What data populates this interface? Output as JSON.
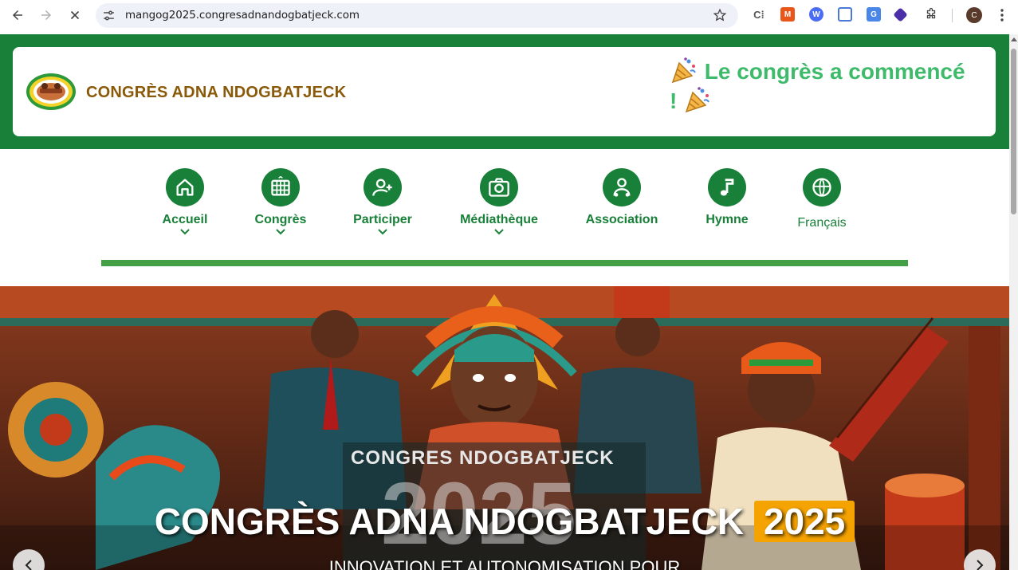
{
  "browser": {
    "url": "mangog2025.congresadnandogbatjeck.com",
    "profile_initial": "C"
  },
  "header": {
    "brand": "CONGRÈS ADNA NDOGBATJECK",
    "announcement_line1": "Le congrès a commencé",
    "announcement_line2": "!"
  },
  "nav": {
    "items": [
      {
        "label": "Accueil",
        "icon": "home-icon",
        "dropdown": true
      },
      {
        "label": "Congrès",
        "icon": "abacus-icon",
        "dropdown": true
      },
      {
        "label": "Participer",
        "icon": "user-add-icon",
        "dropdown": true
      },
      {
        "label": "Médiathèque",
        "icon": "camera-icon",
        "dropdown": true
      },
      {
        "label": "Association",
        "icon": "network-user-icon",
        "dropdown": false
      },
      {
        "label": "Hymne",
        "icon": "music-note-icon",
        "dropdown": false
      },
      {
        "label": "Français",
        "icon": "globe-icon",
        "dropdown": false
      }
    ]
  },
  "hero": {
    "title": "CONGRÈS ADNA NDOGBATJECK",
    "year": "2025",
    "subtitle": "INNOVATION ET AUTONOMISATION POUR",
    "poster_text": "CONGRES NDOGBATJECK",
    "poster_year": "2025"
  },
  "colors": {
    "primary_green": "#188038",
    "accent_green": "#3dba6a",
    "brand_brown": "#8a5a0a",
    "badge_orange": "#f5a300"
  }
}
